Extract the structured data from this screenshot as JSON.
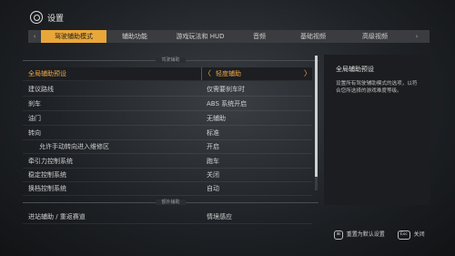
{
  "header": {
    "title": "设置"
  },
  "tabs": {
    "prev_icon": "‹",
    "next_icon": "›",
    "items": [
      {
        "label": "驾驶辅助模式",
        "active": true
      },
      {
        "label": "辅助功能"
      },
      {
        "label": "游戏玩法和 HUD"
      },
      {
        "label": "音频"
      },
      {
        "label": "基础视频"
      },
      {
        "label": "高级视频"
      }
    ]
  },
  "sections": {
    "driving_assists": "驾驶辅助",
    "other_assists": "额外辅助"
  },
  "rows": [
    {
      "label": "全局辅助预设",
      "value": "轻度辅助"
    },
    {
      "label": "建议路线",
      "value": "仅需要刹车时"
    },
    {
      "label": "刹车",
      "value": "ABS 系统开启"
    },
    {
      "label": "油门",
      "value": "无辅助"
    },
    {
      "label": "转向",
      "value": "标准"
    },
    {
      "label": "允许手动转向进入维修区",
      "value": "开启"
    },
    {
      "label": "牵引力控制系统",
      "value": "跑车"
    },
    {
      "label": "稳定控制系统",
      "value": "关闭"
    },
    {
      "label": "换档控制系统",
      "value": "自动"
    },
    {
      "label": "进站辅助 / 重返赛道",
      "value": "情境感应"
    }
  ],
  "arrows": {
    "left": "〈",
    "right": "〉"
  },
  "panel": {
    "title": "全局辅助预设",
    "description": "设置所有驾驶辅助模式的选项，以符合您所选择的游戏难度等级。"
  },
  "footer": {
    "reset_key": "⊞",
    "reset_label": "重置为默认设置",
    "close_key": "Esc",
    "close_label": "关闭"
  }
}
